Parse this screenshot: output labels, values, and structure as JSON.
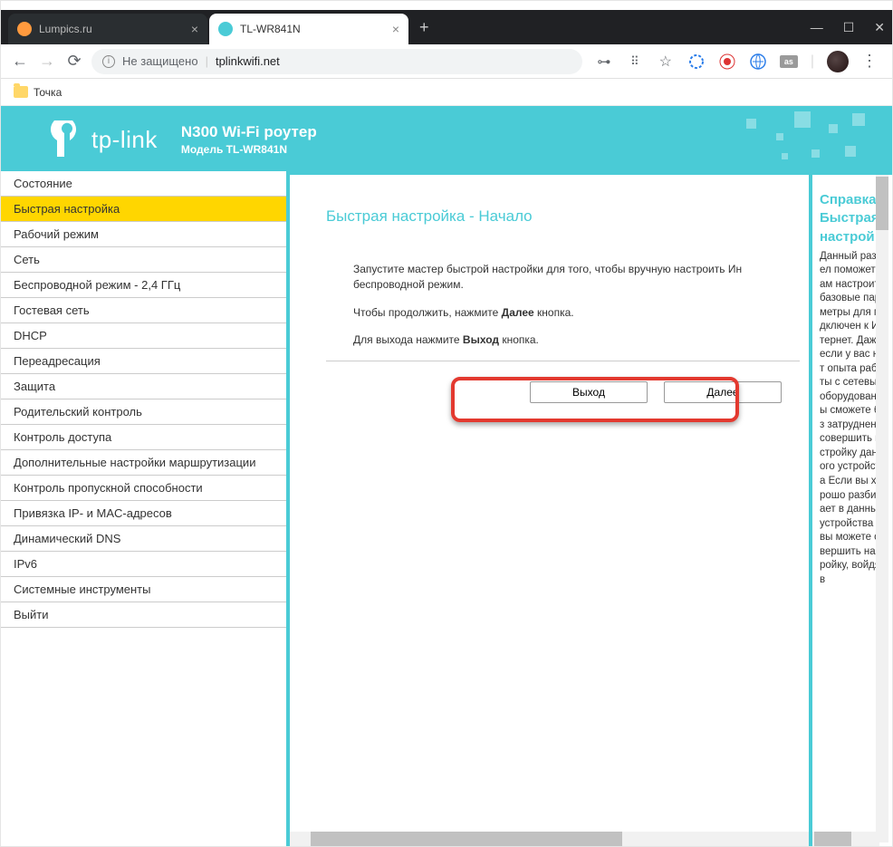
{
  "browser": {
    "tabs": [
      {
        "title": "Lumpics.ru",
        "active": false,
        "favicon_color": "#ff9a3e"
      },
      {
        "title": "TL-WR841N",
        "active": true,
        "favicon_color": "#4acbd6"
      }
    ],
    "url_security": "Не защищено",
    "url": "tplinkwifi.net",
    "bookmark": "Точка"
  },
  "header": {
    "brand": "tp-link",
    "title": "N300 Wi-Fi роутер",
    "subtitle": "Модель TL-WR841N"
  },
  "sidebar": {
    "items": [
      "Состояние",
      "Быстрая настройка",
      "Рабочий режим",
      "Сеть",
      "Беспроводной режим - 2,4 ГГц",
      "Гостевая сеть",
      "DHCP",
      "Переадресация",
      "Защита",
      "Родительский контроль",
      "Контроль доступа",
      "Дополнительные настройки маршрутизации",
      "Контроль пропускной способности",
      "Привязка IP- и MAC-адресов",
      "Динамический DNS",
      "IPv6",
      "Системные инструменты",
      "Выйти"
    ],
    "active_index": 1
  },
  "main": {
    "title": "Быстрая настройка - Начало",
    "line1_a": "Запустите мастер быстрой настройки для того, чтобы вручную настроить Ин",
    "line1_b": "беспроводной режим.",
    "line2_a": "Чтобы продолжить, нажмите ",
    "line2_b": "Далее",
    "line2_c": " кнопка.",
    "line3_a": "Для выхода нажмите ",
    "line3_b": "Выход",
    "line3_c": " кнопка.",
    "btn_exit": "Выход",
    "btn_next": "Далее"
  },
  "help": {
    "title": "Справка Быстрая настрой",
    "body": "Данный раздел поможет вам настроить базовые параметры для подключен к Интернет. Даже если у вас нет опыта работы с сетевым оборудован вы сможете без затруднени совершить настройку данного устройства Если вы хорошо разбирает в данных устройства то вы можете совершить настройку, войдя в"
  }
}
